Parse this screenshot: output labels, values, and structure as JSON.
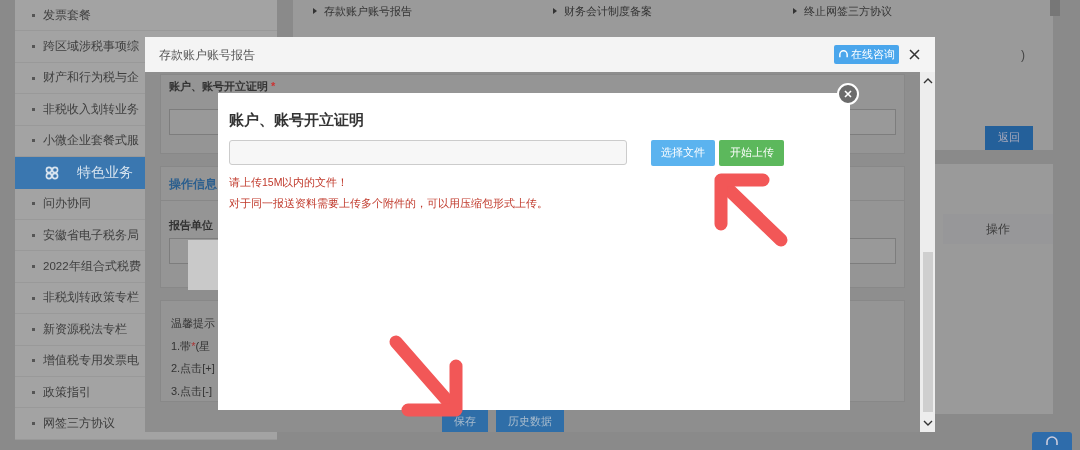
{
  "sidebar": {
    "items": [
      {
        "kind": "link",
        "label": "发票套餐"
      },
      {
        "kind": "link",
        "label": "跨区域涉税事项综"
      },
      {
        "kind": "link",
        "label": "财产和行为税与企"
      },
      {
        "kind": "link",
        "label": "非税收入划转业务"
      },
      {
        "kind": "link",
        "label": "小微企业套餐式服"
      },
      {
        "kind": "section",
        "label": "特色业务"
      },
      {
        "kind": "link",
        "label": "问办协同"
      },
      {
        "kind": "link",
        "label": "安徽省电子税务局"
      },
      {
        "kind": "link",
        "label": "2022年组合式税费"
      },
      {
        "kind": "link",
        "label": "非税划转政策专栏"
      },
      {
        "kind": "link",
        "label": "新资源税法专栏"
      },
      {
        "kind": "link",
        "label": "增值税专用发票电"
      },
      {
        "kind": "link",
        "label": "政策指引"
      },
      {
        "kind": "link",
        "label": "网签三方协议"
      }
    ]
  },
  "main": {
    "links": [
      "存款账户账号报告",
      "财务会计制度备案",
      "终止网签三方协议"
    ],
    "side_mark": ")",
    "back_button": "返回",
    "table_header": "操作"
  },
  "dialog": {
    "title": "存款账户账号报告",
    "consult_button": "在线咨询",
    "field_label": "账户、账号开立证明",
    "required_mark": "*",
    "section_title": "操作信息",
    "unit_label": "报告单位",
    "tips_title": "温馨提示",
    "tips": [
      {
        "prefix": "1.带",
        "mark": "*",
        "rest": "(星"
      },
      {
        "prefix": "2.点击[+]"
      },
      {
        "prefix": "3.点击[-]"
      }
    ],
    "buttons": [
      "保存",
      "历史数据"
    ]
  },
  "upload_dialog": {
    "title": "账户、账号开立证明",
    "choose_button": "选择文件",
    "upload_button": "开始上传",
    "notes": [
      "请上传15M以内的文件！",
      "对于同一报送资料需要上传多个附件的，可以用压缩包形式上传。"
    ]
  }
}
